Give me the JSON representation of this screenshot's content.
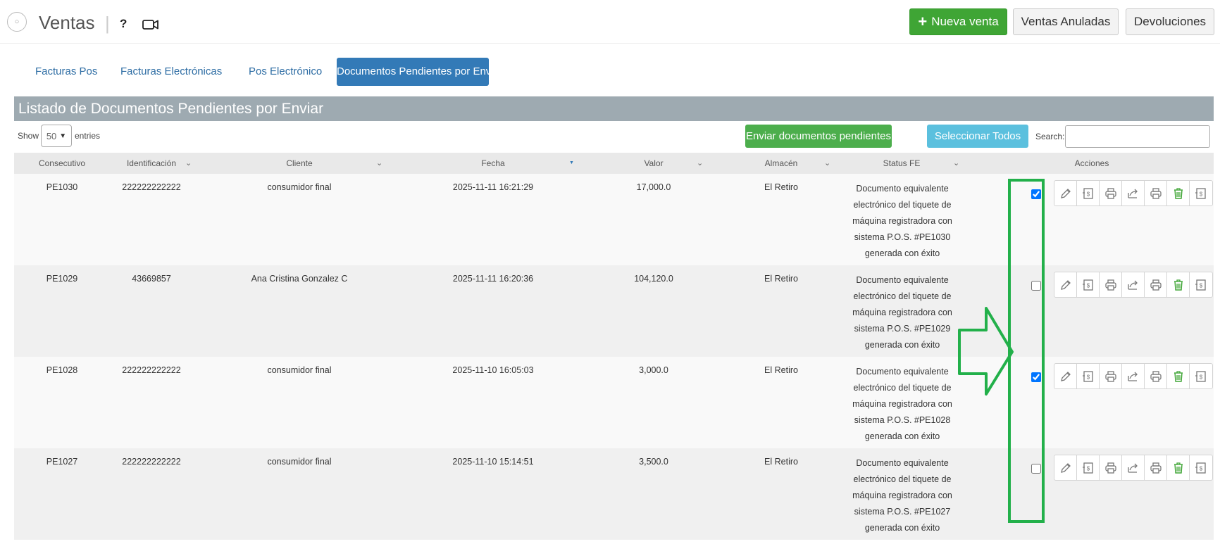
{
  "header": {
    "title": "Ventas",
    "separator": "|",
    "help_label": "?",
    "new_sale_label": "Nueva venta",
    "cancelled_sales_label": "Ventas Anuladas",
    "returns_label": "Devoluciones"
  },
  "tabs": [
    {
      "label": "Facturas Pos"
    },
    {
      "label": "Facturas Electrónicas"
    },
    {
      "label": "Pos Electrónico"
    },
    {
      "label": "Documentos Pendientes por Enviar"
    }
  ],
  "list": {
    "title": "Listado de Documentos Pendientes por Enviar",
    "show_label": "Show",
    "entries_label": "entries",
    "page_size": "50",
    "send_pending_label": "Enviar documentos pendientes",
    "select_all_label": "Seleccionar Todos",
    "search_label": "Search:",
    "search_value": ""
  },
  "columns": [
    "Consecutivo",
    "Identificación",
    "Cliente",
    "Fecha",
    "Valor",
    "Almacén",
    "Status FE",
    "Acciones"
  ],
  "rows": [
    {
      "consecutivo": "PE1030",
      "identificacion": "222222222222",
      "cliente": "consumidor final",
      "fecha": "2025-11-11 16:21:29",
      "valor": "17,000.0",
      "almacen": "El Retiro",
      "status": [
        "Documento equivalente",
        "electrónico del tiquete de",
        "máquina registradora con",
        "sistema P.O.S. #PE1030",
        "generada con éxito"
      ],
      "checked": true
    },
    {
      "consecutivo": "PE1029",
      "identificacion": "43669857",
      "cliente": "Ana Cristina Gonzalez C",
      "fecha": "2025-11-11 16:20:36",
      "valor": "104,120.0",
      "almacen": "El Retiro",
      "status": [
        "Documento equivalente",
        "electrónico del tiquete de",
        "máquina registradora con",
        "sistema P.O.S. #PE1029",
        "generada con éxito"
      ],
      "checked": false
    },
    {
      "consecutivo": "PE1028",
      "identificacion": "222222222222",
      "cliente": "consumidor final",
      "fecha": "2025-11-10 16:05:03",
      "valor": "3,000.0",
      "almacen": "El Retiro",
      "status": [
        "Documento equivalente",
        "electrónico del tiquete de",
        "máquina registradora con",
        "sistema P.O.S. #PE1028",
        "generada con éxito"
      ],
      "checked": true
    },
    {
      "consecutivo": "PE1027",
      "identificacion": "222222222222",
      "cliente": "consumidor final",
      "fecha": "2025-11-10 15:14:51",
      "valor": "3,500.0",
      "almacen": "El Retiro",
      "status": [
        "Documento equivalente",
        "electrónico del tiquete de",
        "máquina registradora con",
        "sistema P.O.S. #PE1027",
        "generada con éxito"
      ],
      "checked": false
    }
  ],
  "actions": [
    {
      "icon": "pencil-icon"
    },
    {
      "icon": "money-doc-icon"
    },
    {
      "icon": "printer-icon"
    },
    {
      "icon": "share-icon"
    },
    {
      "icon": "printer-icon"
    },
    {
      "icon": "trash-icon"
    },
    {
      "icon": "money-doc-icon"
    }
  ],
  "colors": {
    "primary": "#337ab7",
    "success": "#3fa535",
    "info": "#5bc0de",
    "header_gray": "#9eaab1",
    "annotation_green": "#22b04a"
  }
}
